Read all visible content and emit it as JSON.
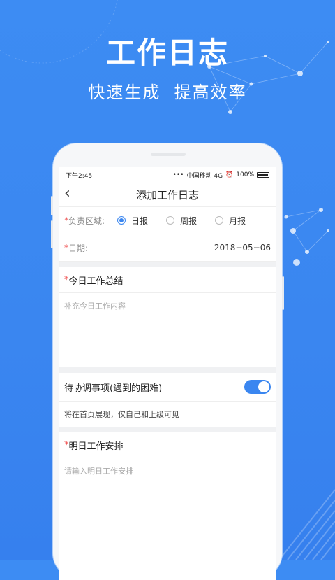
{
  "hero": {
    "title": "工作日志",
    "subtitle": "快速生成  提高效率"
  },
  "status": {
    "time": "下午2:45",
    "carrier": "中国移动 4G",
    "battery": "100%"
  },
  "nav": {
    "back_icon": "chevron-left",
    "title": "添加工作日志"
  },
  "form": {
    "area": {
      "required": "*",
      "label": "负责区域:",
      "options": [
        "日报",
        "周报",
        "月报"
      ],
      "selected": "日报"
    },
    "date": {
      "required": "*",
      "label": "日期:",
      "value": "2018−05−06"
    },
    "today": {
      "required": "*",
      "title": "今日工作总结",
      "placeholder": "补充今日工作内容"
    },
    "coordinate": {
      "title": "待协调事项(遇到的困难)",
      "toggle_on": true,
      "note": "将在首页展现，仅自己和上级可见"
    },
    "tomorrow": {
      "required": "*",
      "title": "明日工作安排",
      "placeholder": "请输入明日工作安排"
    }
  },
  "colors": {
    "accent": "#3a86f0",
    "background": "#3d8cf3",
    "required": "#f04a4a"
  }
}
